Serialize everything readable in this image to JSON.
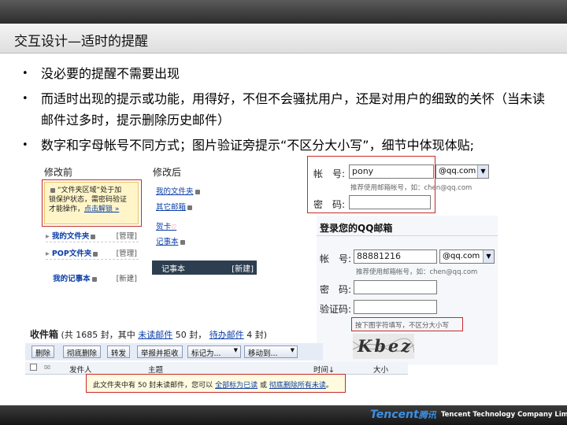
{
  "slide": {
    "title": "交互设计—适时的提醒",
    "bullets": [
      "没必要的提醒不需要出现",
      "而适时出现的提示或功能，用得好，不但不会骚扰用户，还是对用户的细致的关怀（当未读邮件过多时，提示删除历史邮件）",
      "数字和字母帐号不同方式；图片验证旁提示“不区分大小写”，细节中体现体贴;"
    ]
  },
  "before": {
    "label": "修改前",
    "lock_notice_a": "“文件夹区域”处于加",
    "lock_notice_b": "锁保护状态，需密码验证",
    "lock_notice_c": "才能操作，",
    "lock_notice_link": "点击解锁 »",
    "rows": [
      {
        "name": "我的文件夹",
        "action": "[管理]"
      },
      {
        "name": "POP文件夹",
        "action": "[管理]"
      },
      {
        "name": "我的记事本",
        "action": "[新建]"
      }
    ]
  },
  "after": {
    "label": "修改后",
    "links": [
      "我的文件夹",
      "其它邮箱",
      "贺卡",
      "记事本"
    ],
    "note_label": "记事本",
    "note_action": "[新建]"
  },
  "login1": {
    "account_label": "帐　号:",
    "account_value": "pony",
    "domain": "@qq.com",
    "hint": "推荐使用邮箱帐号，如：chen@qq.com",
    "password_label": "密　码:"
  },
  "login2": {
    "title": "登录您的QQ邮箱",
    "account_label": "帐　号:",
    "account_value": "88881216",
    "domain": "@qq.com",
    "hint": "推荐使用邮箱帐号，如：chen@qq.com",
    "password_label": "密　码:",
    "captcha_label": "验证码:",
    "captcha_hint": "按下图字符填写，不区分大小写",
    "captcha_text": "Kbez"
  },
  "inbox": {
    "title": "收件箱",
    "summary_a": "(共 1685 封，其中",
    "unread_link": "未读邮件",
    "summary_b": "50 封，",
    "pending_link": "待办邮件",
    "summary_c": "4 封)",
    "buttons": [
      "删除",
      "彻底删除",
      "转发",
      "举报并拒收",
      "标记为...",
      "移动到..."
    ],
    "columns": {
      "sender": "发件人",
      "subject": "主题",
      "time": "时间↓",
      "size": "大小"
    },
    "notice_a": "此文件夹中有 50 封未读邮件，您可以",
    "notice_link1": "全部标为已读",
    "notice_b": "或",
    "notice_link2": "彻底删除所有未读",
    "notice_c": "。"
  },
  "footer": {
    "logo": "Tencent",
    "logo_cn": "腾讯",
    "company": "Tencent Technology Company Limited"
  }
}
